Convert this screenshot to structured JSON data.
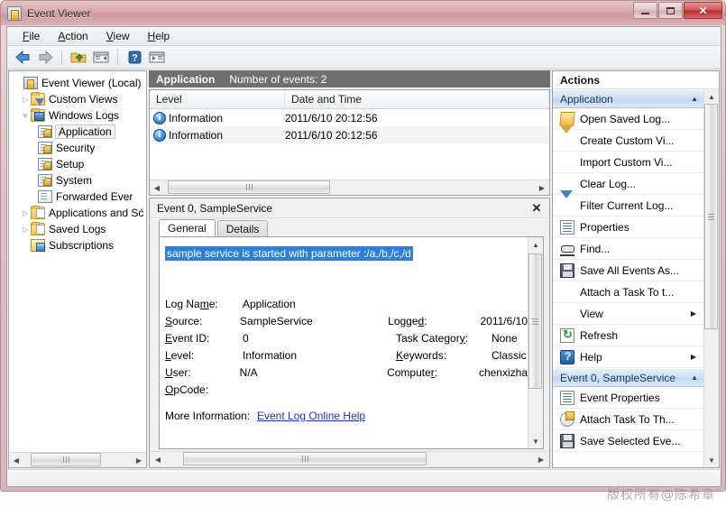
{
  "window": {
    "title": "Event Viewer",
    "app_icon": "event-viewer-icon",
    "minimize_label": "Minimize",
    "maximize_label": "Restore",
    "close_label": "Close"
  },
  "menubar": {
    "items": [
      {
        "label": "File",
        "accel": "F"
      },
      {
        "label": "Action",
        "accel": "A"
      },
      {
        "label": "View",
        "accel": "V"
      },
      {
        "label": "Help",
        "accel": "H"
      }
    ]
  },
  "toolbar": {
    "buttons": [
      {
        "name": "back-button",
        "icon": "left-arrow-icon"
      },
      {
        "name": "forward-button",
        "icon": "right-arrow-icon"
      },
      {
        "name": "up-one-level-button",
        "icon": "folder-up-icon"
      },
      {
        "name": "show-hide-console-tree-button",
        "icon": "console-tree-icon"
      },
      {
        "name": "help-button",
        "icon": "question-mark-icon"
      },
      {
        "name": "show-hide-action-pane-button",
        "icon": "action-pane-icon"
      }
    ]
  },
  "tree": {
    "nodes": [
      {
        "label": "Event Viewer (Local)",
        "indent": 0,
        "twist": "",
        "icon": "event-viewer-icon",
        "selected": false
      },
      {
        "label": "Custom Views",
        "indent": 1,
        "twist": "collapsed",
        "icon": "folder-filter-icon",
        "selected": false
      },
      {
        "label": "Windows Logs",
        "indent": 1,
        "twist": "expanded",
        "icon": "folder-blue-icon",
        "selected": false
      },
      {
        "label": "Application",
        "indent": 2,
        "twist": "",
        "icon": "log-key-icon",
        "selected": true
      },
      {
        "label": "Security",
        "indent": 2,
        "twist": "",
        "icon": "log-key-icon",
        "selected": false
      },
      {
        "label": "Setup",
        "indent": 2,
        "twist": "",
        "icon": "log-key-icon",
        "selected": false
      },
      {
        "label": "System",
        "indent": 2,
        "twist": "",
        "icon": "log-key-icon",
        "selected": false
      },
      {
        "label": "Forwarded Ever",
        "indent": 2,
        "twist": "",
        "icon": "log-icon",
        "selected": false
      },
      {
        "label": "Applications and Sć",
        "indent": 1,
        "twist": "collapsed",
        "icon": "folder-stack-icon",
        "selected": false
      },
      {
        "label": "Saved Logs",
        "indent": 1,
        "twist": "collapsed",
        "icon": "folder-stack-icon",
        "selected": false
      },
      {
        "label": "Subscriptions",
        "indent": 1,
        "twist": "",
        "icon": "subscriptions-icon",
        "selected": false
      }
    ]
  },
  "center": {
    "header": {
      "title": "Application",
      "count_text": "Number of events: 2"
    },
    "columns": [
      {
        "key": "level",
        "label": "Level"
      },
      {
        "key": "datetime",
        "label": "Date and Time"
      }
    ],
    "rows": [
      {
        "level": "Information",
        "icon": "information-icon",
        "datetime": "2011/6/10 20:12:56"
      },
      {
        "level": "Information",
        "icon": "information-icon",
        "datetime": "2011/6/10 20:12:56"
      }
    ]
  },
  "details": {
    "title": "Event 0, SampleService",
    "close_label": "✕",
    "tabs": [
      {
        "label": "General",
        "active": true
      },
      {
        "label": "Details",
        "active": false
      }
    ],
    "message": "sample service is started with parameter :/a,/b,/c,/d",
    "properties_left": [
      {
        "key": "Log Name:",
        "accel_index": 5,
        "value": "Application"
      },
      {
        "key": "Source:",
        "accel_index": 0,
        "value": "SampleService"
      },
      {
        "key": "Event ID:",
        "accel_index": 0,
        "value": "0"
      },
      {
        "key": "Level:",
        "accel_index": 0,
        "value": "Information"
      },
      {
        "key": "User:",
        "accel_index": 0,
        "value": "N/A"
      },
      {
        "key": "OpCode:",
        "accel_index": 0,
        "value": ""
      }
    ],
    "properties_right": [
      {
        "key": "",
        "value": ""
      },
      {
        "key": "Logged:",
        "value": "2011/6/10"
      },
      {
        "key": "Task Category:",
        "value": "None"
      },
      {
        "key": "Keywords:",
        "value": "Classic"
      },
      {
        "key": "Computer:",
        "value": "chenxizha"
      },
      {
        "key": "",
        "value": ""
      }
    ],
    "more_information_label": "More Information:",
    "more_information_link": "Event Log Online Help"
  },
  "actions": {
    "title": "Actions",
    "groups": [
      {
        "name": "application-group",
        "label": "Application",
        "chevron": "▲",
        "items": [
          {
            "label": "Open Saved Log...",
            "icon": "open-saved-log-icon",
            "submenu": false
          },
          {
            "label": "Create Custom Vi...",
            "icon": "create-custom-view-icon",
            "submenu": false
          },
          {
            "label": "Import Custom Vi...",
            "icon": "",
            "submenu": false
          },
          {
            "label": "Clear Log...",
            "icon": "",
            "submenu": false
          },
          {
            "label": "Filter Current Log...",
            "icon": "filter-icon",
            "submenu": false
          },
          {
            "label": "Properties",
            "icon": "properties-icon",
            "submenu": false
          },
          {
            "label": "Find...",
            "icon": "find-icon",
            "submenu": false
          },
          {
            "label": "Save All Events As...",
            "icon": "save-icon",
            "submenu": false
          },
          {
            "label": "Attach a Task To t...",
            "icon": "",
            "submenu": false
          },
          {
            "label": "View",
            "icon": "",
            "submenu": true
          },
          {
            "label": "Refresh",
            "icon": "refresh-icon",
            "submenu": false
          },
          {
            "label": "Help",
            "icon": "help-icon",
            "submenu": true
          }
        ]
      },
      {
        "name": "event-group",
        "label": "Event 0, SampleService",
        "chevron": "▲",
        "items": [
          {
            "label": "Event Properties",
            "icon": "event-properties-icon",
            "submenu": false
          },
          {
            "label": "Attach Task To Th...",
            "icon": "attach-task-icon",
            "submenu": false
          },
          {
            "label": "Save Selected Eve...",
            "icon": "save-icon",
            "submenu": false
          }
        ]
      }
    ]
  },
  "watermark": {
    "text": "版权所有@陈希章"
  },
  "colors": {
    "header_bar": "#6f6f6f",
    "selection_blue": "#2f7fd8",
    "link_blue": "#1a38c8",
    "group_header_blue": "#cfe0f5",
    "window_border": "#b48d93"
  }
}
